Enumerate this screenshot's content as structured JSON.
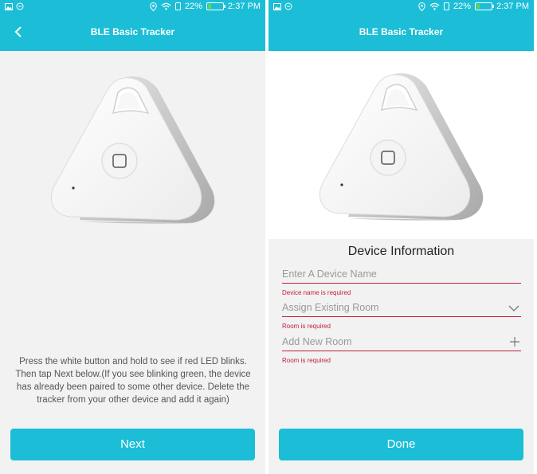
{
  "status_bar": {
    "battery_level": "22%",
    "time": "2:37 PM",
    "battery_fill": 0.22,
    "icons": [
      "image-icon",
      "sync-icon",
      "location-icon",
      "wifi-icon",
      "portrait-icon",
      "battery-icon"
    ]
  },
  "screen_left": {
    "title": "BLE Basic Tracker",
    "back_icon": "chevron-left-icon",
    "instructions": "Press the white button and hold to see if red LED blinks. Then tap Next below.(If you see blinking green, the device has already been paired to some other device. Delete the tracker from your other device and add it again)",
    "next_label": "Next"
  },
  "screen_right": {
    "title": "BLE Basic Tracker",
    "form_title": "Device Information",
    "device_name": {
      "placeholder": "Enter A Device Name",
      "error": "Device name is required"
    },
    "room_select": {
      "placeholder": "Assign Existing Room",
      "error": "Room is required",
      "icon": "chevron-down-icon"
    },
    "new_room": {
      "placeholder": "Add New Room",
      "error": "Room is required",
      "icon": "plus-icon"
    },
    "done_label": "Done"
  },
  "colors": {
    "accent": "#1bbed6",
    "error": "#c0203a"
  }
}
